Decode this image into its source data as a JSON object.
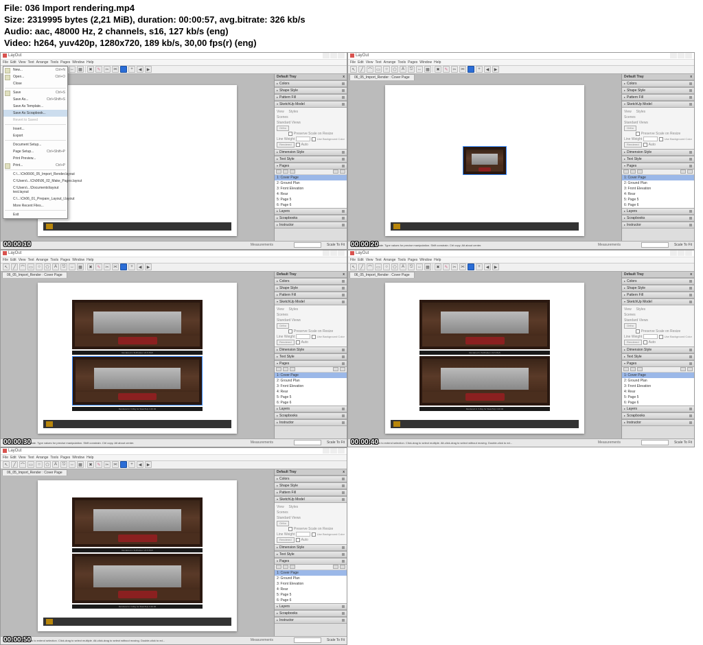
{
  "metadata": {
    "file": "File: 036 Import rendering.mp4",
    "size": "Size: 2319995 bytes (2,21 MiB), duration: 00:00:57, avg.bitrate: 326 kb/s",
    "audio": "Audio: aac, 48000 Hz, 2 channels, s16, 127 kb/s (eng)",
    "video": "Video: h264, yuv420p, 1280x720, 189 kb/s, 30,00 fps(r) (eng)"
  },
  "app_title": "LayOut",
  "menubar": [
    "File",
    "Edit",
    "View",
    "Text",
    "Arrange",
    "Tools",
    "Pages",
    "Window",
    "Help"
  ],
  "dropdown": {
    "items": [
      {
        "label": "New...",
        "shortcut": "Ctrl+N",
        "icon": true
      },
      {
        "label": "Open...",
        "shortcut": "Ctrl+O",
        "icon": true
      },
      {
        "label": "Close"
      },
      {
        "sep": true
      },
      {
        "label": "Save",
        "shortcut": "Ctrl+S",
        "icon": true
      },
      {
        "label": "Save As...",
        "shortcut": "Ctrl+Shift+S"
      },
      {
        "label": "Save As Template..."
      },
      {
        "label": "Save As Scrapbook...",
        "hl": true
      },
      {
        "label": "Revert to Saved",
        "dim": true
      },
      {
        "sep": true
      },
      {
        "label": "Insert..."
      },
      {
        "label": "Export"
      },
      {
        "sep": true
      },
      {
        "label": "Document Setup..."
      },
      {
        "label": "Page Setup...",
        "shortcut": "Ctrl+Shift+P"
      },
      {
        "label": "Print Preview..."
      },
      {
        "label": "Print...",
        "shortcut": "Ctrl+P",
        "icon": true
      },
      {
        "sep": true
      },
      {
        "label": "C:\\...\\Ch06\\06_05_Import_Render.layout"
      },
      {
        "label": "C:\\Users\\...\\Ch06\\06_02_Make_Pages.layout"
      },
      {
        "label": "C:\\Users\\...\\Documents\\layout test.layout"
      },
      {
        "label": "C:\\...\\Ch06_01_Prepare_Layout_t.layout"
      },
      {
        "label": "More Recent Files..."
      },
      {
        "sep": true
      },
      {
        "label": "Exit"
      }
    ]
  },
  "doctab": "06_05_Import_Render : Cover Page",
  "tray": {
    "title": "Default Tray",
    "panels": [
      "Colors",
      "Shape Style",
      "Pattern Fill",
      "SketchUp Model"
    ],
    "su_view": "View",
    "su_styles": "Styles",
    "su_scenes": "Scenes",
    "su_std": "Standard Views",
    "su_ortho": "Ortho",
    "su_preserve": "Preserve Scale on Resize",
    "su_lw": "Line Weight",
    "su_lw_val": "0.50 pt",
    "su_bg": "Use Background Color",
    "su_render": "Rendered",
    "su_auto": "Auto",
    "panels2": [
      "Dimension Style",
      "Text Style",
      "Pages"
    ],
    "pages": [
      "1: Cover Page",
      "2: Ground Plan",
      "3: Front Elevation",
      "4: Rear",
      "5: Page 5",
      "6: Page 6"
    ],
    "panels3": [
      "Layers",
      "Scrapbooks",
      "Instructor"
    ]
  },
  "status": {
    "hint1": "Drag pins to scale or rotate. Type values for precise manipulation. Shift constrain. Ctrl copy. Alt about center.",
    "hint2": "Select objects. Shift-click to extend selection. Click-drag to select multiple. Alt-click-drag to select without moving. Double-click to ed...",
    "meas": "Measurements",
    "zoom": "Scale To Fit"
  },
  "timestamps": [
    "00:00:10",
    "00:00:20",
    "00:00:30",
    "00:00:40",
    "00:00:50"
  ],
  "caption1": "Rendered in SUPodium V2.5 Plu5",
  "caption2": "Rendered in V-Ray for SketchUp 3.40.02"
}
